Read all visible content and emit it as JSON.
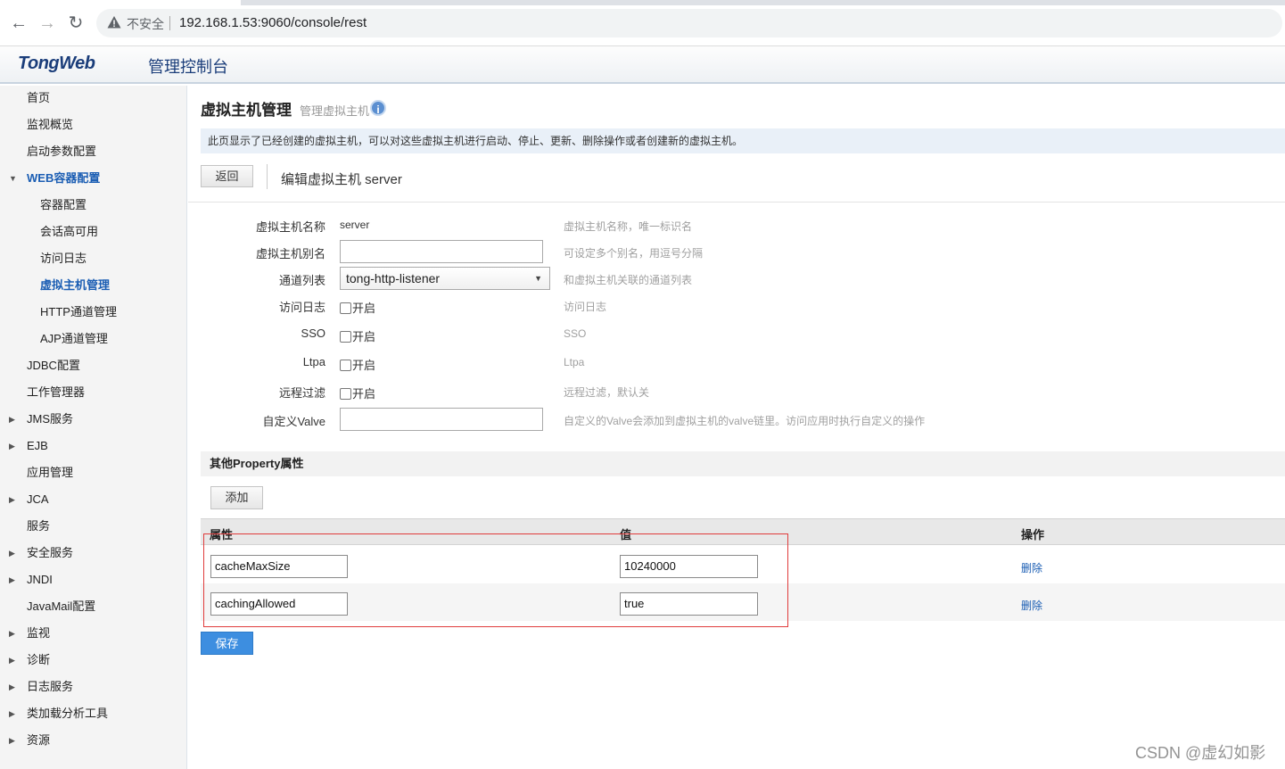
{
  "browser": {
    "back_icon": "←",
    "forward_icon": "→",
    "reload_icon": "↻",
    "insecure_label": "不安全",
    "url": "192.168.1.53:9060/console/rest"
  },
  "header": {
    "brand": "TongWeb",
    "title": "管理控制台"
  },
  "sidebar": {
    "items": [
      {
        "label": "首页",
        "arrow": "",
        "sub": false,
        "active": false
      },
      {
        "label": "监视概览",
        "arrow": "",
        "sub": false,
        "active": false
      },
      {
        "label": "启动参数配置",
        "arrow": "",
        "sub": false,
        "active": false
      },
      {
        "label": "WEB容器配置",
        "arrow": "▼",
        "sub": false,
        "active": true
      },
      {
        "label": "容器配置",
        "arrow": "",
        "sub": true,
        "active": false
      },
      {
        "label": "会话高可用",
        "arrow": "",
        "sub": true,
        "active": false
      },
      {
        "label": "访问日志",
        "arrow": "",
        "sub": true,
        "active": false
      },
      {
        "label": "虚拟主机管理",
        "arrow": "",
        "sub": true,
        "active": true
      },
      {
        "label": "HTTP通道管理",
        "arrow": "",
        "sub": true,
        "active": false
      },
      {
        "label": "AJP通道管理",
        "arrow": "",
        "sub": true,
        "active": false
      },
      {
        "label": "JDBC配置",
        "arrow": "",
        "sub": false,
        "active": false
      },
      {
        "label": "工作管理器",
        "arrow": "",
        "sub": false,
        "active": false
      },
      {
        "label": "JMS服务",
        "arrow": "▶",
        "sub": false,
        "active": false
      },
      {
        "label": "EJB",
        "arrow": "▶",
        "sub": false,
        "active": false
      },
      {
        "label": "应用管理",
        "arrow": "",
        "sub": false,
        "active": false
      },
      {
        "label": "JCA",
        "arrow": "▶",
        "sub": false,
        "active": false
      },
      {
        "label": "服务",
        "arrow": "",
        "sub": false,
        "active": false
      },
      {
        "label": "安全服务",
        "arrow": "▶",
        "sub": false,
        "active": false
      },
      {
        "label": "JNDI",
        "arrow": "▶",
        "sub": false,
        "active": false
      },
      {
        "label": "JavaMail配置",
        "arrow": "",
        "sub": false,
        "active": false
      },
      {
        "label": "监视",
        "arrow": "▶",
        "sub": false,
        "active": false
      },
      {
        "label": "诊断",
        "arrow": "▶",
        "sub": false,
        "active": false
      },
      {
        "label": "日志服务",
        "arrow": "▶",
        "sub": false,
        "active": false
      },
      {
        "label": "类加载分析工具",
        "arrow": "▶",
        "sub": false,
        "active": false
      },
      {
        "label": "资源",
        "arrow": "▶",
        "sub": false,
        "active": false
      }
    ]
  },
  "main": {
    "title": "虚拟主机管理",
    "subtitle": "管理虚拟主机",
    "info_icon": "i",
    "description": "此页显示了已经创建的虚拟主机，可以对这些虚拟主机进行启动、停止、更新、删除操作或者创建新的虚拟主机。",
    "back_label": "返回",
    "edit_title": "编辑虚拟主机 server"
  },
  "form": {
    "name_label": "虚拟主机名称",
    "name_value": "server",
    "name_hint": "虚拟主机名称，唯一标识名",
    "alias_label": "虚拟主机别名",
    "alias_value": "",
    "alias_hint": "可设定多个别名，用逗号分隔",
    "channel_label": "通道列表",
    "channel_value": "tong-http-listener",
    "channel_hint": "和虚拟主机关联的通道列表",
    "accesslog_label": "访问日志",
    "accesslog_check": "开启",
    "accesslog_hint": "访问日志",
    "sso_label": "SSO",
    "sso_check": "开启",
    "sso_hint": "SSO",
    "ltpa_label": "Ltpa",
    "ltpa_check": "开启",
    "ltpa_hint": "Ltpa",
    "remote_label": "远程过滤",
    "remote_check": "开启",
    "remote_hint": "远程过滤，默认关",
    "valve_label": "自定义Valve",
    "valve_value": "",
    "valve_hint": "自定义的Valve会添加到虚拟主机的valve链里。访问应用时执行自定义的操作"
  },
  "properties": {
    "section_title": "其他Property属性",
    "add_label": "添加",
    "col_attr": "属性",
    "col_value": "值",
    "col_action": "操作",
    "rows": [
      {
        "key": "cacheMaxSize",
        "value": "10240000",
        "action": "删除"
      },
      {
        "key": "cachingAllowed",
        "value": "true",
        "action": "删除"
      }
    ],
    "save_label": "保存"
  },
  "watermark": "CSDN @虚幻如影"
}
